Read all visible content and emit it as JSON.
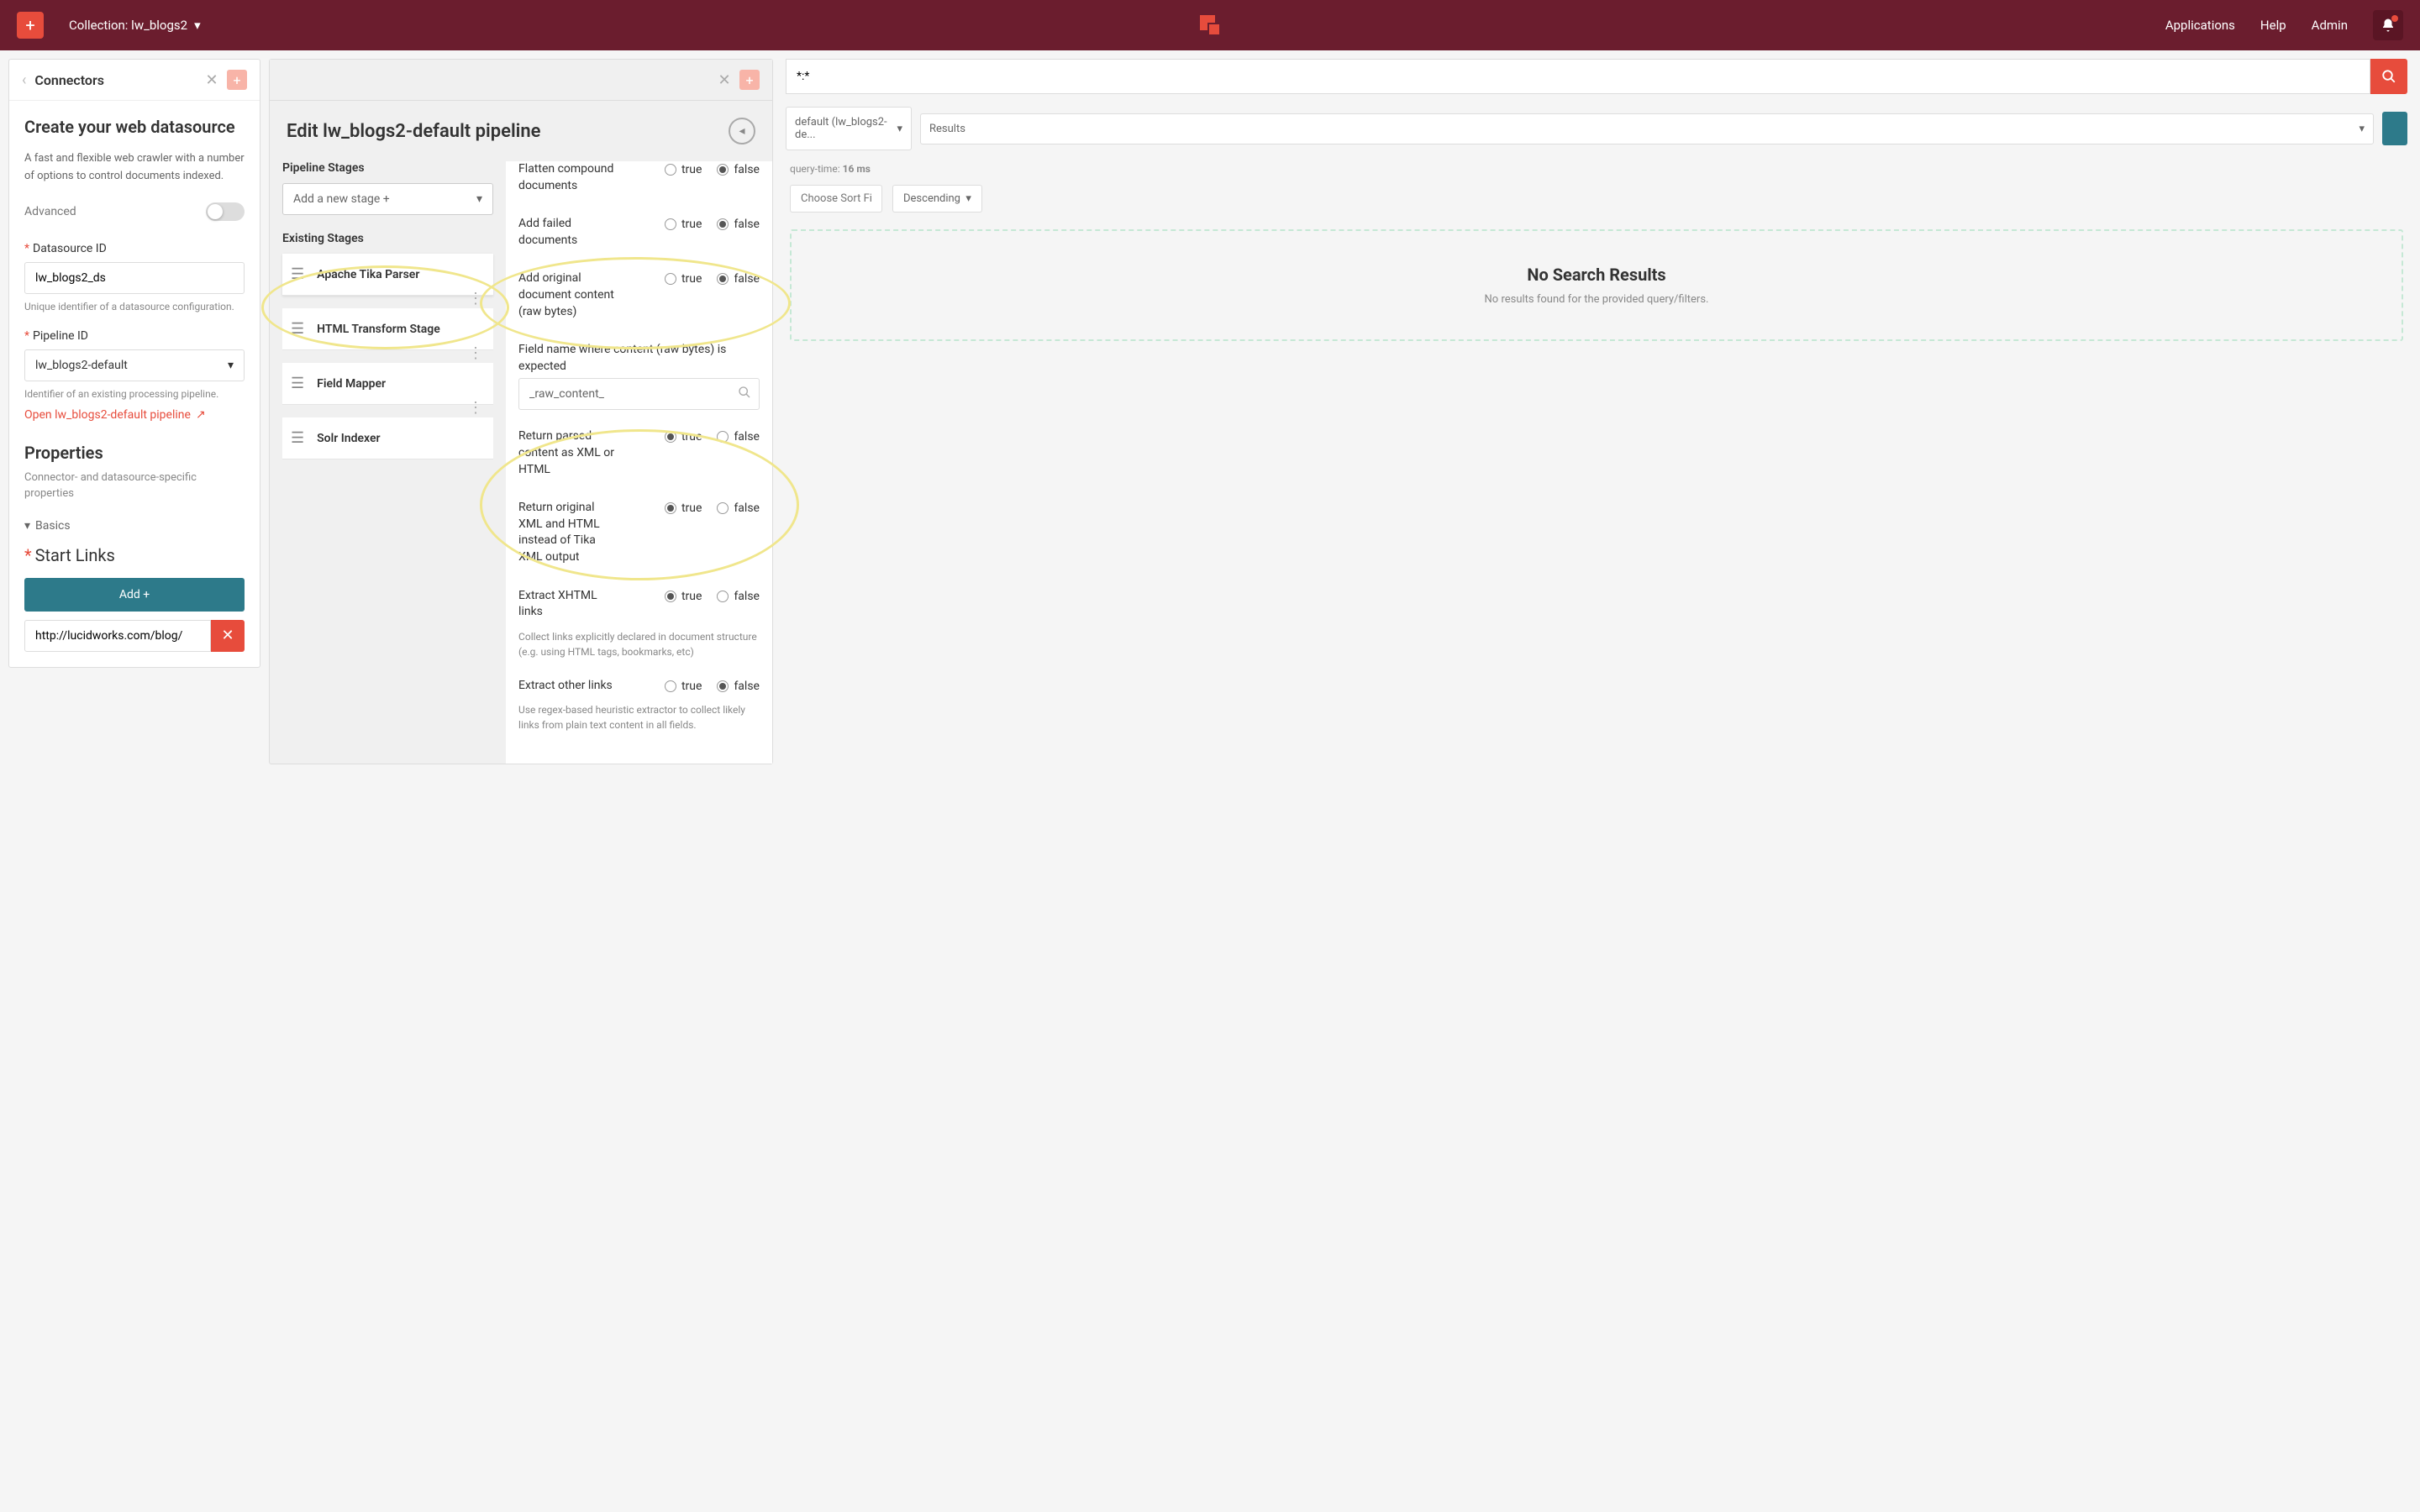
{
  "topbar": {
    "collection_label": "Collection: lw_blogs2",
    "nav": {
      "applications": "Applications",
      "help": "Help",
      "admin": "Admin"
    }
  },
  "left": {
    "title": "Connectors",
    "heading": "Create your web datasource",
    "desc": "A fast and flexible web crawler with a number of options to control documents indexed.",
    "advanced_label": "Advanced",
    "datasource_id_label": "Datasource ID",
    "datasource_id_value": "lw_blogs2_ds",
    "datasource_id_hint": "Unique identifier of a datasource configuration.",
    "pipeline_id_label": "Pipeline ID",
    "pipeline_id_value": "lw_blogs2-default",
    "pipeline_id_hint": "Identifier of an existing processing pipeline.",
    "open_pipeline_link": "Open lw_blogs2-default pipeline",
    "properties_title": "Properties",
    "properties_sub": "Connector- and datasource-specific properties",
    "basics_label": "Basics",
    "start_links_label": "Start Links",
    "add_btn": "Add +",
    "start_link_value": "http://lucidworks.com/blog/"
  },
  "middle": {
    "title": "Edit lw_blogs2-default pipeline",
    "pipeline_stages_label": "Pipeline Stages",
    "add_stage_placeholder": "Add a new stage +",
    "existing_stages_label": "Existing Stages",
    "stages": [
      {
        "name": "Apache Tika Parser"
      },
      {
        "name": "HTML Transform Stage"
      },
      {
        "name": "Field Mapper"
      },
      {
        "name": "Solr Indexer"
      }
    ],
    "options": {
      "flatten": {
        "label": "Flatten compound documents",
        "value": "false"
      },
      "add_failed": {
        "label": "Add failed documents",
        "value": "false"
      },
      "add_original": {
        "label": "Add original document content (raw bytes)",
        "value": "false"
      },
      "field_name_label": "Field name where content (raw bytes) is expected",
      "field_name_value": "_raw_content_",
      "return_xml": {
        "label": "Return parsed content as XML or HTML",
        "value": "true"
      },
      "return_original": {
        "label": "Return original XML and HTML instead of Tika XML output",
        "value": "true"
      },
      "extract_xhtml": {
        "label": "Extract XHTML links",
        "value": "true",
        "hint": "Collect links explicitly declared in document structure (e.g. using HTML tags, bookmarks, etc)"
      },
      "extract_other": {
        "label": "Extract other links",
        "value": "false",
        "hint": "Use regex-based heuristic extractor to collect likely links from plain text content in all fields."
      }
    },
    "true_label": "true",
    "false_label": "false"
  },
  "right": {
    "search_value": "*:*",
    "default_dropdown": "default (lw_blogs2-de...",
    "results_dropdown": "Results",
    "query_time_label": "query-time:",
    "query_time_value": "16 ms",
    "sort_placeholder": "Choose Sort Fie",
    "sort_order": "Descending",
    "no_results_title": "No Search Results",
    "no_results_desc": "No results found for the provided query/filters."
  }
}
